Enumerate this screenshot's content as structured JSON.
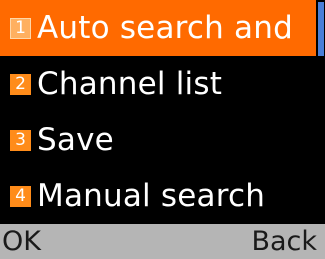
{
  "menu": {
    "items": [
      {
        "number": "1",
        "label": "Auto search and",
        "selected": true
      },
      {
        "number": "2",
        "label": "Channel list",
        "selected": false
      },
      {
        "number": "3",
        "label": "Save",
        "selected": false
      },
      {
        "number": "4",
        "label": "Manual search",
        "selected": false
      }
    ]
  },
  "softkeys": {
    "left": "OK",
    "right": "Back"
  },
  "colors": {
    "background": "#000000",
    "selection": "#ff6a00",
    "number_badge": "#ff8c1a",
    "scroll_thumb": "#4a7fd8",
    "softkey_bar": "#b5b5b5"
  }
}
